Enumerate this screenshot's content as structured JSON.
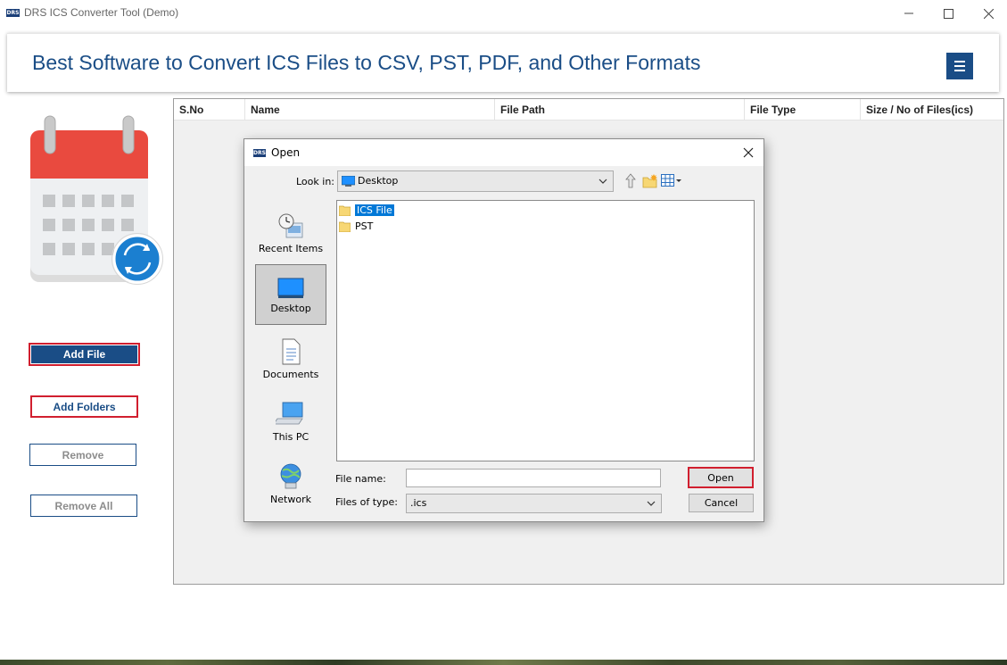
{
  "window": {
    "logo_text": "DRS",
    "title": "DRS ICS Converter Tool (Demo)"
  },
  "banner": {
    "title": "Best Software to Convert ICS Files to CSV, PST, PDF, and Other Formats"
  },
  "sidebar": {
    "buttons": [
      {
        "label": "Add File"
      },
      {
        "label": "Add Folders"
      },
      {
        "label": "Remove"
      },
      {
        "label": "Remove All"
      }
    ]
  },
  "table": {
    "columns": [
      "S.No",
      "Name",
      "File Path",
      "File Type",
      "Size / No of Files(ics)"
    ]
  },
  "dialog": {
    "title": "Open",
    "look_in_label": "Look in:",
    "look_in_value": "Desktop",
    "places": [
      {
        "label": "Recent Items",
        "icon": "recent-items-icon"
      },
      {
        "label": "Desktop",
        "icon": "desktop-icon",
        "active": true
      },
      {
        "label": "Documents",
        "icon": "documents-icon"
      },
      {
        "label": "This PC",
        "icon": "this-pc-icon"
      },
      {
        "label": "Network",
        "icon": "network-icon"
      }
    ],
    "files": [
      {
        "name": "ICS File",
        "selected": true
      },
      {
        "name": "PST",
        "selected": false
      }
    ],
    "file_name_label": "File name:",
    "file_name_value": "",
    "file_type_label": "Files of type:",
    "file_type_value": ".ics",
    "open_label": "Open",
    "cancel_label": "Cancel"
  },
  "colors": {
    "brand_blue": "#1a4d86",
    "accent_red": "#d11f2f",
    "selection_blue": "#0078d7"
  }
}
